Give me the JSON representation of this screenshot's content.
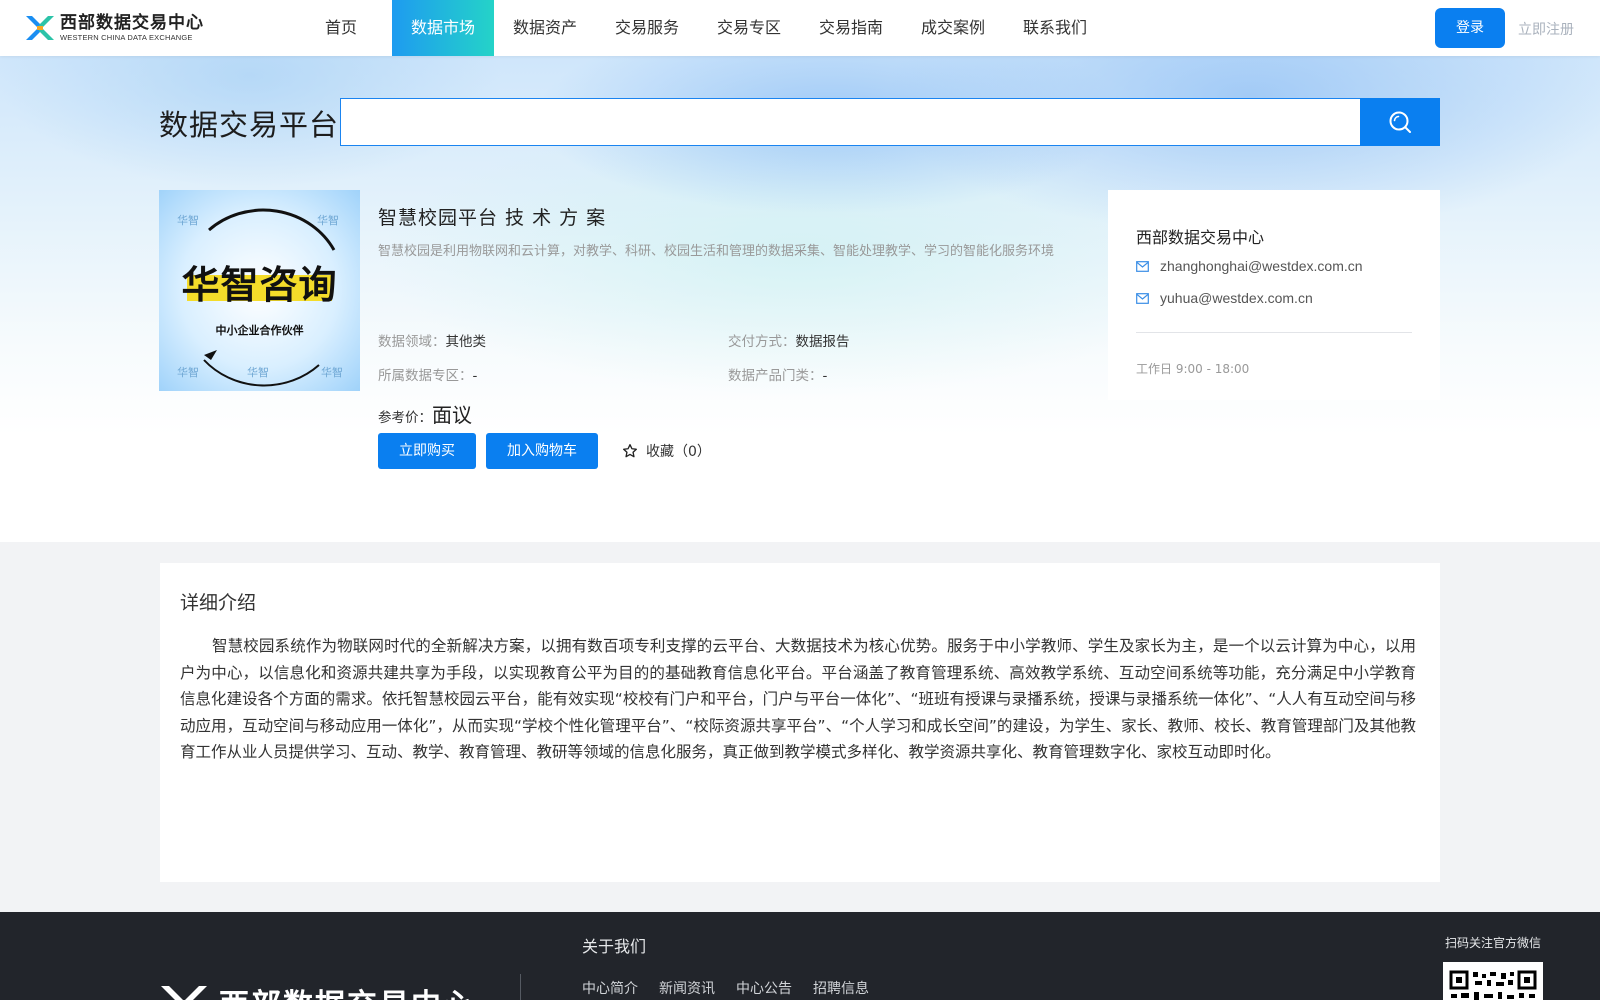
{
  "header": {
    "logo_cn": "西部数据交易中心",
    "logo_en": "WESTERN CHINA DATA EXCHANGE",
    "nav": [
      "首页",
      "数据市场",
      "数据资产",
      "交易服务",
      "交易专区",
      "交易指南",
      "成交案例",
      "联系我们"
    ],
    "active_nav": "数据市场",
    "login": "登录",
    "register": "立即注册"
  },
  "search": {
    "title": "数据交易平台",
    "placeholder": "",
    "value": ""
  },
  "product": {
    "image_text_main": "华智咨询",
    "image_text_sub": "中小企业合作伙伴",
    "title": "智慧校园平台 技 术 方 案",
    "description": "智慧校园是利用物联网和云计算，对教学、科研、校园生活和管理的数据采集、智能处理教学、学习的智能化服务环境",
    "attrs": {
      "domain_label": "数据领域：",
      "domain_value": "其他类",
      "delivery_label": "交付方式：",
      "delivery_value": "数据报告",
      "zone_label": "所属数据专区：",
      "zone_value": "-",
      "category_label": "数据产品门类：",
      "category_value": "-"
    },
    "price_label": "参考价：",
    "price_value": "面议",
    "buy_now": "立即购买",
    "add_cart": "加入购物车",
    "favorite": "收藏（0）"
  },
  "contact": {
    "title": "西部数据交易中心",
    "email1": "zhanghonghai@westdex.com.cn",
    "email2": "yuhua@westdex.com.cn",
    "hours": "工作日 9:00 - 18:00"
  },
  "detail": {
    "title": "详细介绍",
    "body": "智慧校园系统作为物联网时代的全新解决方案，以拥有数百项专利支撑的云平台、大数据技术为核心优势。服务于中小学教师、学生及家长为主，是一个以云计算为中心，以用户为中心，以信息化和资源共建共享为手段，以实现教育公平为目的的基础教育信息化平台。平台涵盖了教育管理系统、高效教学系统、互动空间系统等功能，充分满足中小学教育信息化建设各个方面的需求。依托智慧校园云平台，能有效实现“校校有门户和平台，门户与平台一体化”、“班班有授课与录播系统，授课与录播系统一体化”、“人人有互动空间与移动应用，互动空间与移动应用一体化”，从而实现“学校个性化管理平台”、“校际资源共享平台”、“个人学习和成长空间”的建设，为学生、家长、教师、校长、教育管理部门及其他教育工作从业人员提供学习、互动、教学、教育管理、教研等领域的信息化服务，真正做到教学模式多样化、教学资源共享化、教育管理数字化、家校互动即时化。"
  },
  "footer": {
    "logo_cn": "西部数据交易中心",
    "about": "关于我们",
    "links": [
      "中心简介",
      "新闻资讯",
      "中心公告",
      "招聘信息"
    ],
    "qr_label": "扫码关注官方微信"
  },
  "colors": {
    "primary": "#0a7ff0",
    "nav_active_start": "#1e9bf0",
    "nav_active_end": "#24d3c8",
    "footer_bg": "#22252b"
  }
}
